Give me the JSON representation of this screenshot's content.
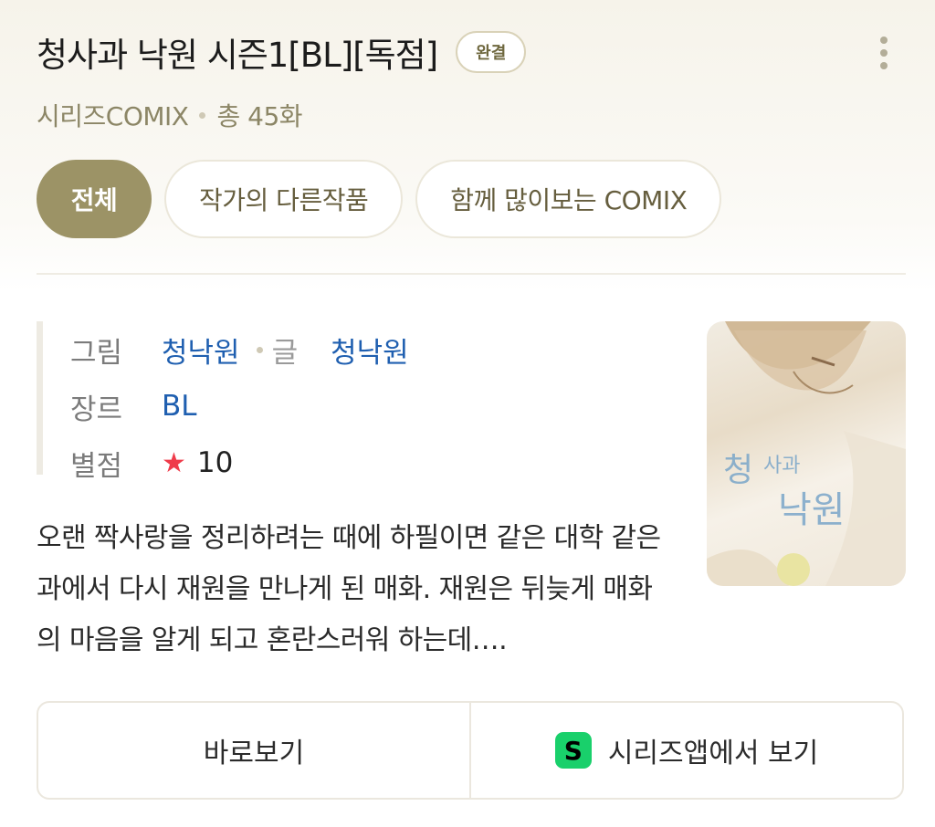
{
  "header": {
    "title": "청사과 낙원 시즌1[BL][독점]",
    "status_badge": "완결",
    "publisher": "시리즈COMIX",
    "episode_count": "총 45화"
  },
  "tabs": [
    {
      "label": "전체",
      "active": true
    },
    {
      "label": "작가의 다른작품",
      "active": false
    },
    {
      "label": "함께 많이보는 COMIX",
      "active": false
    }
  ],
  "info": {
    "art_label": "그림",
    "art_value": "청낙원",
    "story_label": "글",
    "story_value": "청낙원",
    "genre_label": "장르",
    "genre_value": "BL",
    "rating_label": "별점",
    "rating_value": "10"
  },
  "cover": {
    "title_text": "청사과 낙원"
  },
  "description": "오랜 짝사랑을 정리하려는 때에 하필이면 같은 대학 같은 과에서 다시 재원을 만나게 된 매화. 재원은 뒤늦게 매화의 마음을 알게 되고 혼란스러워 하는데….",
  "actions": {
    "read_now": "바로보기",
    "series_app_icon_letter": "S",
    "open_in_app": "시리즈앱에서 보기"
  },
  "colors": {
    "accent": "#9c9366",
    "link": "#1f5fb0",
    "star": "#ef3b4a",
    "series_green": "#19d06b"
  },
  "icons": [
    "more-vertical-icon",
    "star-icon",
    "series-app-icon"
  ]
}
